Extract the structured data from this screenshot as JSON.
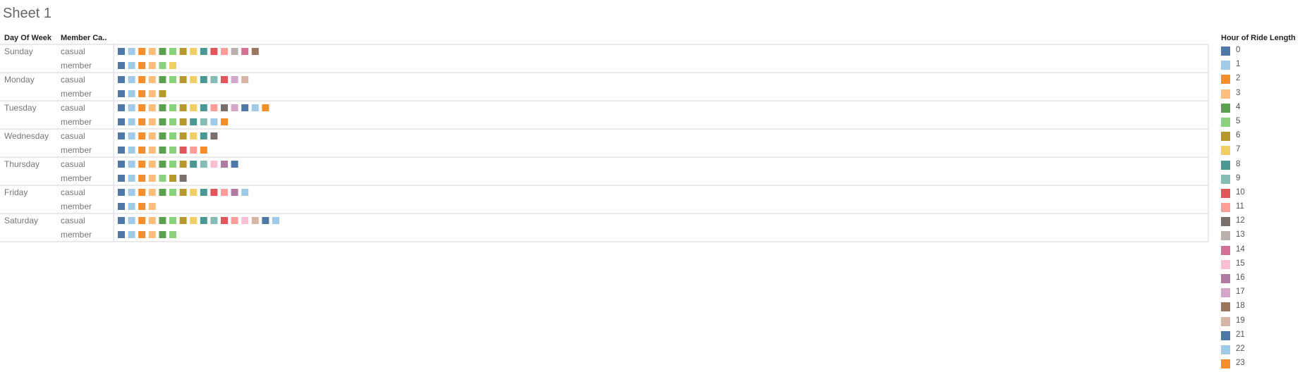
{
  "sheet": {
    "title": "Sheet 1"
  },
  "headers": {
    "day": "Day Of Week",
    "member": "Member Ca.."
  },
  "legend": {
    "title": "Hour of Ride Length"
  },
  "colors": {
    "0": "#4e79a7",
    "1": "#a0cbe8",
    "2": "#f28e2b",
    "3": "#ffbe7d",
    "4": "#59a14f",
    "5": "#8cd17d",
    "6": "#b6992d",
    "7": "#f1ce63",
    "8": "#499894",
    "9": "#86bcb6",
    "10": "#e15759",
    "11": "#ff9d9a",
    "12": "#79706e",
    "13": "#bab0ac",
    "14": "#d37295",
    "15": "#fabfd2",
    "16": "#b07aa1",
    "17": "#d4a6c8",
    "18": "#9d7660",
    "19": "#d7b5a6",
    "21": "#4e79a7",
    "22": "#a0cbe8",
    "23": "#f28e2b"
  },
  "chart_data": {
    "type": "table",
    "color_field": "Hour of Ride Length",
    "legend_entries": [
      0,
      1,
      2,
      3,
      4,
      5,
      6,
      7,
      8,
      9,
      10,
      11,
      12,
      13,
      14,
      15,
      16,
      17,
      18,
      19,
      21,
      22,
      23
    ],
    "rows": [
      {
        "day": "Sunday",
        "categories": [
          {
            "member": "casual",
            "hours": [
              0,
              1,
              2,
              3,
              4,
              5,
              6,
              7,
              8,
              10,
              11,
              13,
              14,
              18
            ]
          },
          {
            "member": "member",
            "hours": [
              0,
              1,
              2,
              3,
              5,
              7
            ]
          }
        ]
      },
      {
        "day": "Monday",
        "categories": [
          {
            "member": "casual",
            "hours": [
              0,
              1,
              2,
              3,
              4,
              5,
              6,
              7,
              8,
              9,
              10,
              17,
              19
            ]
          },
          {
            "member": "member",
            "hours": [
              0,
              1,
              2,
              3,
              6
            ]
          }
        ]
      },
      {
        "day": "Tuesday",
        "categories": [
          {
            "member": "casual",
            "hours": [
              0,
              1,
              2,
              3,
              4,
              5,
              6,
              7,
              8,
              11,
              12,
              17,
              21,
              22,
              23
            ]
          },
          {
            "member": "member",
            "hours": [
              0,
              1,
              2,
              3,
              4,
              5,
              6,
              8,
              9,
              22,
              23
            ]
          }
        ]
      },
      {
        "day": "Wednesday",
        "categories": [
          {
            "member": "casual",
            "hours": [
              0,
              1,
              2,
              3,
              4,
              5,
              6,
              7,
              8,
              12
            ]
          },
          {
            "member": "member",
            "hours": [
              0,
              1,
              2,
              3,
              4,
              5,
              10,
              11,
              23
            ]
          }
        ]
      },
      {
        "day": "Thursday",
        "categories": [
          {
            "member": "casual",
            "hours": [
              0,
              1,
              2,
              3,
              4,
              5,
              6,
              8,
              9,
              15,
              16,
              21
            ]
          },
          {
            "member": "member",
            "hours": [
              0,
              1,
              2,
              3,
              5,
              6,
              12
            ]
          }
        ]
      },
      {
        "day": "Friday",
        "categories": [
          {
            "member": "casual",
            "hours": [
              0,
              1,
              2,
              3,
              4,
              5,
              6,
              7,
              8,
              10,
              11,
              16,
              22
            ]
          },
          {
            "member": "member",
            "hours": [
              0,
              1,
              2,
              3
            ]
          }
        ]
      },
      {
        "day": "Saturday",
        "categories": [
          {
            "member": "casual",
            "hours": [
              0,
              1,
              2,
              3,
              4,
              5,
              6,
              7,
              8,
              9,
              10,
              11,
              15,
              19,
              21,
              22
            ]
          },
          {
            "member": "member",
            "hours": [
              0,
              1,
              2,
              3,
              4,
              5
            ]
          }
        ]
      }
    ]
  }
}
